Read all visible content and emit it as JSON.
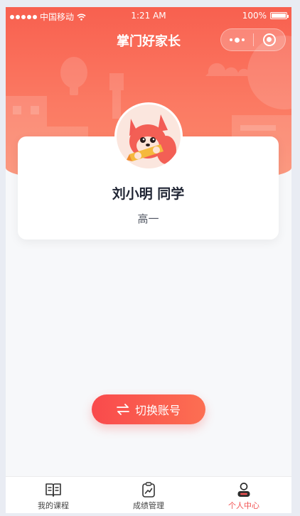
{
  "status_bar": {
    "carrier": "中国移动",
    "time": "1:21 AM",
    "battery": "100%"
  },
  "nav": {
    "title": "掌门好家长"
  },
  "profile": {
    "name": "刘小明 同学",
    "grade": "高一"
  },
  "actions": {
    "switch_account": "切换账号"
  },
  "tabbar": {
    "items": [
      {
        "label": "我的课程",
        "icon": "book-icon"
      },
      {
        "label": "成绩管理",
        "icon": "clipboard-chart-icon"
      },
      {
        "label": "个人中心",
        "icon": "user-icon"
      }
    ],
    "active_index": 2
  },
  "colors": {
    "brand": "#f8604f",
    "accent": "#f94a4c",
    "active_tab": "#f25353"
  }
}
